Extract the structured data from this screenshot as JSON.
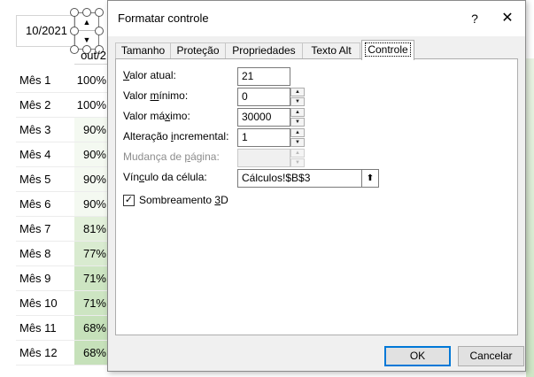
{
  "sheet": {
    "date_cell": "10/2021",
    "col_header": "out/2",
    "rows": [
      {
        "label": "Mês 1",
        "value": "100%",
        "bg": "#ffffff"
      },
      {
        "label": "Mês 2",
        "value": "100%",
        "bg": "#ffffff"
      },
      {
        "label": "Mês 3",
        "value": "90%",
        "bg": "#f4f9f1"
      },
      {
        "label": "Mês 4",
        "value": "90%",
        "bg": "#f4f9f1"
      },
      {
        "label": "Mês 5",
        "value": "90%",
        "bg": "#f4f9f1"
      },
      {
        "label": "Mês 6",
        "value": "90%",
        "bg": "#f4f9f1"
      },
      {
        "label": "Mês 7",
        "value": "81%",
        "bg": "#e2f0da"
      },
      {
        "label": "Mês 8",
        "value": "77%",
        "bg": "#d9ebd0"
      },
      {
        "label": "Mês 9",
        "value": "71%",
        "bg": "#cde5c2"
      },
      {
        "label": "Mês 10",
        "value": "71%",
        "bg": "#cde5c2"
      },
      {
        "label": "Mês 11",
        "value": "68%",
        "bg": "#c6e1ba"
      },
      {
        "label": "Mês 12",
        "value": "68%",
        "bg": "#c6e1ba"
      }
    ]
  },
  "dialog": {
    "title": "Formatar controle",
    "help": "?",
    "close": "✕",
    "tabs": [
      "Tamanho",
      "Proteção",
      "Propriedades",
      "Texto Alt",
      "Controle"
    ],
    "active_tab": "Controle",
    "fields": {
      "current_value": {
        "label_pre": "",
        "label_u": "V",
        "label_post": "alor atual:",
        "value": "21"
      },
      "min_value": {
        "label_pre": "Valor ",
        "label_u": "m",
        "label_post": "ínimo:",
        "value": "0"
      },
      "max_value": {
        "label_pre": "Valor má",
        "label_u": "x",
        "label_post": "imo:",
        "value": "30000"
      },
      "increment": {
        "label_pre": "Alteração ",
        "label_u": "i",
        "label_post": "ncremental:",
        "value": "1"
      },
      "page_change": {
        "label_pre": "Mudança de ",
        "label_u": "p",
        "label_post": "ágina:",
        "value": ""
      },
      "cell_link": {
        "label_pre": "Vín",
        "label_u": "c",
        "label_post": "ulo da célula:",
        "value": "Cálculos!$B$3"
      }
    },
    "shading": {
      "label_pre": "Sombreamento ",
      "label_u": "3",
      "label_post": "D",
      "checked": "✓"
    },
    "ok_label": "OK",
    "cancel_label": "Cancelar"
  }
}
